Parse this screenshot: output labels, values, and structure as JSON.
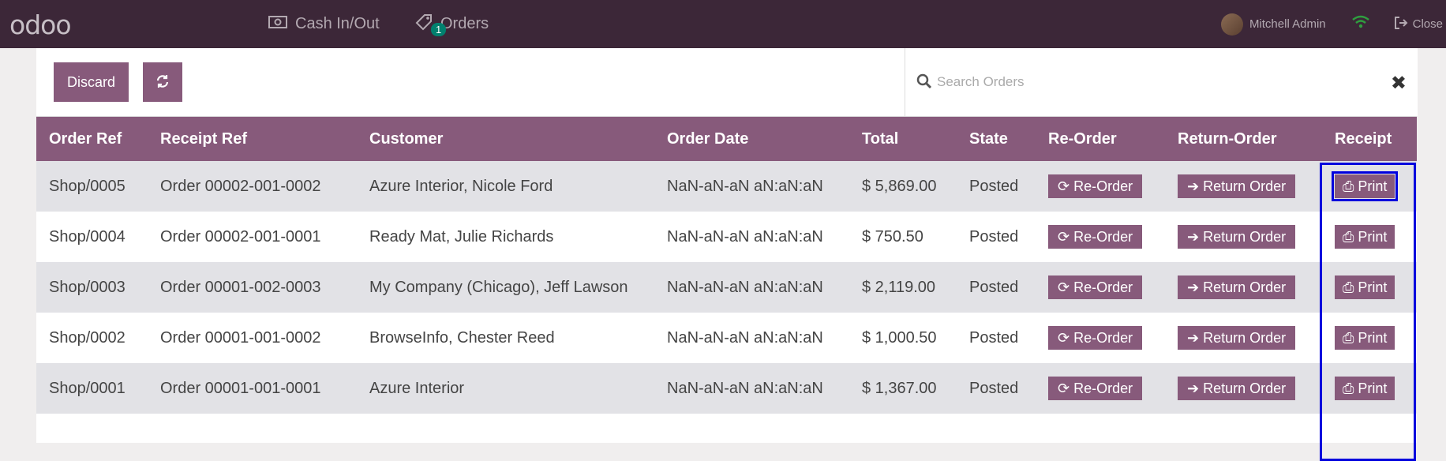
{
  "header": {
    "logo": "odoo",
    "cash_label": "Cash In/Out",
    "orders_label": "Orders",
    "orders_badge": "1",
    "user_name": "Mitchell Admin",
    "close_label": "Close"
  },
  "controls": {
    "discard_label": "Discard",
    "search_placeholder": "Search Orders",
    "search_value": ""
  },
  "table": {
    "columns": [
      "Order Ref",
      "Receipt Ref",
      "Customer",
      "Order Date",
      "Total",
      "State",
      "Re-Order",
      "Return-Order",
      "Receipt"
    ],
    "reorder_label": "Re-Order",
    "return_label": "Return Order",
    "print_label": "Print",
    "rows": [
      {
        "order_ref": "Shop/0005",
        "receipt_ref": "Order 00002-001-0002",
        "customer": "Azure Interior, Nicole Ford",
        "date": "NaN-aN-aN aN:aN:aN",
        "total": "$ 5,869.00",
        "state": "Posted"
      },
      {
        "order_ref": "Shop/0004",
        "receipt_ref": "Order 00002-001-0001",
        "customer": "Ready Mat, Julie Richards",
        "date": "NaN-aN-aN aN:aN:aN",
        "total": "$ 750.50",
        "state": "Posted"
      },
      {
        "order_ref": "Shop/0003",
        "receipt_ref": "Order 00001-002-0003",
        "customer": "My Company (Chicago), Jeff Lawson",
        "date": "NaN-aN-aN aN:aN:aN",
        "total": "$ 2,119.00",
        "state": "Posted"
      },
      {
        "order_ref": "Shop/0002",
        "receipt_ref": "Order 00001-001-0002",
        "customer": "BrowseInfo, Chester Reed",
        "date": "NaN-aN-aN aN:aN:aN",
        "total": "$ 1,000.50",
        "state": "Posted"
      },
      {
        "order_ref": "Shop/0001",
        "receipt_ref": "Order 00001-001-0001",
        "customer": "Azure Interior",
        "date": "NaN-aN-aN aN:aN:aN",
        "total": "$ 1,367.00",
        "state": "Posted"
      }
    ]
  },
  "colors": {
    "topbar": "#3c2738",
    "accent": "#875a7b",
    "highlight": "#0000dd"
  }
}
